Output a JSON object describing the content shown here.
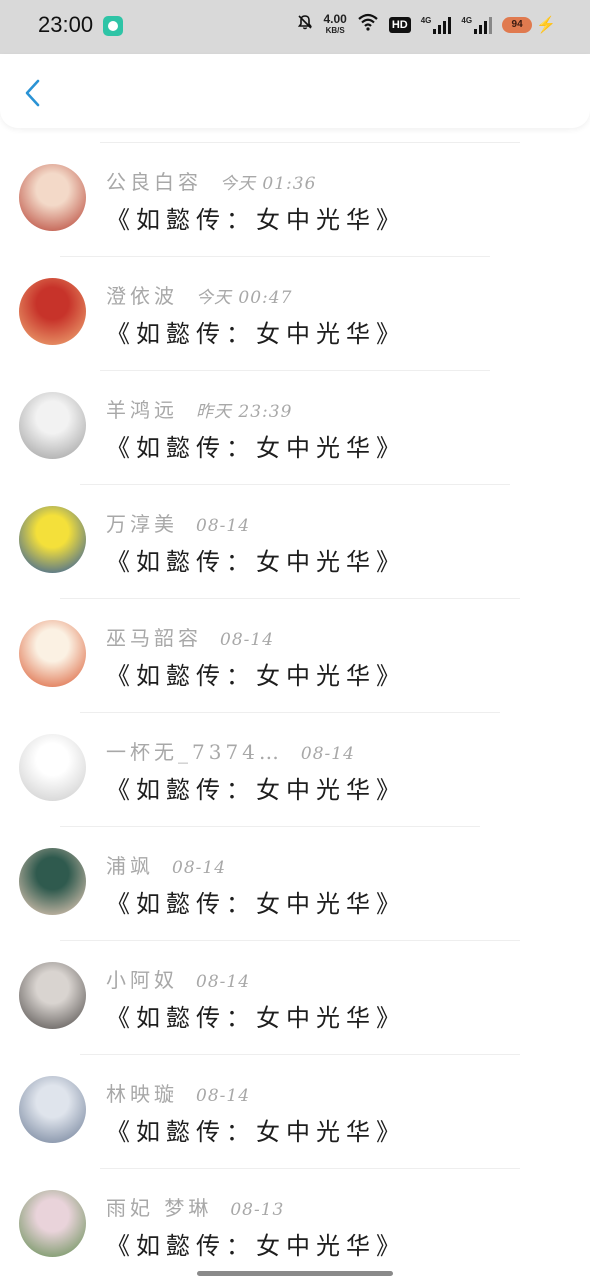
{
  "status_bar": {
    "time": "23:00",
    "speed_value": "4.00",
    "speed_unit": "KB/S",
    "hd_label": "HD",
    "net1": "4G",
    "net2": "4G",
    "battery": "94"
  },
  "comments": [
    {
      "name": "公良白容",
      "date": "今天 01:36",
      "title": "《如懿传：女中光华》",
      "avatar_colors": [
        "#f3d9c8",
        "#b33a2c"
      ]
    },
    {
      "name": "澄依波",
      "date": "今天 00:47",
      "title": "《如懿传：女中光华》",
      "avatar_colors": [
        "#c7332a",
        "#f2b27a"
      ]
    },
    {
      "name": "羊鸿远",
      "date": "昨天 23:39",
      "title": "《如懿传：女中光华》",
      "avatar_colors": [
        "#f2f2f2",
        "#9a9a9a"
      ]
    },
    {
      "name": "万淳美",
      "date": "08-14",
      "title": "《如懿传：女中光华》",
      "avatar_colors": [
        "#f4e03a",
        "#1d4fa8"
      ]
    },
    {
      "name": "巫马韶容",
      "date": "08-14",
      "title": "《如懿传：女中光华》",
      "avatar_colors": [
        "#fbf1e3",
        "#d9572e"
      ]
    },
    {
      "name": "一杯无_7374…",
      "date": "08-14",
      "title": "《如懿传：女中光华》",
      "avatar_colors": [
        "#ffffff",
        "#c8c8c8"
      ]
    },
    {
      "name": "浦飒",
      "date": "08-14",
      "title": "《如懿传：女中光华》",
      "avatar_colors": [
        "#2f5a4e",
        "#f4d4c0"
      ]
    },
    {
      "name": "小阿奴",
      "date": "08-14",
      "title": "《如懿传：女中光华》",
      "avatar_colors": [
        "#d9d4d0",
        "#4a4644"
      ]
    },
    {
      "name": "林映璇",
      "date": "08-14",
      "title": "《如懿传：女中光华》",
      "avatar_colors": [
        "#dfe4ec",
        "#6a7a94"
      ]
    },
    {
      "name": "雨妃  梦琳",
      "date": "08-13",
      "title": "《如懿传：女中光华》",
      "avatar_colors": [
        "#e9d3da",
        "#5d8a4c"
      ]
    }
  ]
}
